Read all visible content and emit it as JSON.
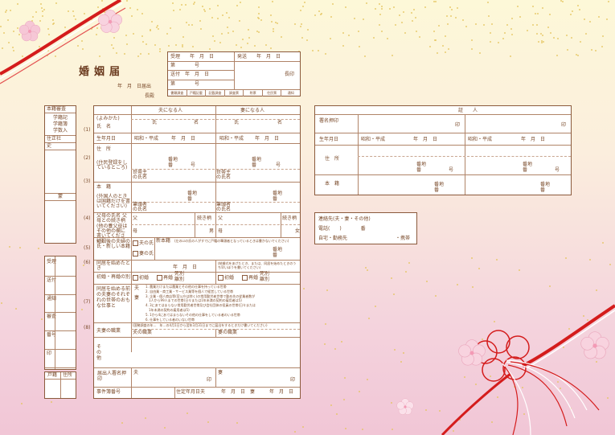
{
  "form": {
    "title": "婚姻届",
    "date_line": "年　月　日届出",
    "to_line": "長殿",
    "reception": {
      "rows": [
        "受理　　年　月　日",
        "第　　　　号",
        "送付　年　月　日",
        "第　　　　号"
      ],
      "right_rows": [
        "発送　　年　月　日",
        "",
        "長印",
        ""
      ],
      "footer": [
        "書類調査",
        "戸籍記載",
        "記載調査",
        "調査票",
        "附票",
        "住民票",
        "通知"
      ]
    },
    "left_strip": {
      "header": "本籍審査",
      "items": [
        "学籍記",
        "学籍簿",
        "学数入"
      ],
      "label2": "住正社",
      "label3": "史",
      "label4": "蒙"
    },
    "columns": {
      "husband": "夫になる人",
      "wife": "妻になる人"
    },
    "rows": {
      "furigana": "(よみかた)",
      "name": "氏　名",
      "family": "氏",
      "given": "名",
      "birth": "生年月日",
      "era": "昭和・平成",
      "ymd": "年　月　日",
      "address": "住　所",
      "address_note": "(住民登録をしているところ)",
      "banchi": "番地",
      "ban": "番",
      "go": "号",
      "setainushi": "世帯主の氏名",
      "honseki": "本　籍",
      "honseki_note": "(外国人のときは国籍だけを書いてください)",
      "hittousha": "筆頭者の氏名",
      "parents": "父母の氏名 父母との続き柄",
      "parents_note": "(他の養父母は その他の欄に 書いてください)",
      "father": "父",
      "mother": "母",
      "relation": "続き柄",
      "son": "男",
      "daughter": "女",
      "new_honseki": "婚姻後の夫婦の 氏・新しい本籍",
      "husband_name": "夫の氏",
      "wife_name": "妻の氏",
      "new_honseki_label": "新本籍",
      "new_honseki_note": "(左の☑の氏の人がすでに戸籍の筆頭者となっているときは書かないでください)",
      "cohabit": "同居を始めたとき",
      "cohabit_note": "(結婚式をあげたとき、または、同居を始めたときのうち早いほうを書いてください)",
      "remarriage": "初婚・再婚の別",
      "first": "初婚",
      "again": "再婚",
      "death": "死別",
      "divorce": "離別",
      "jobs_label": "同居を始める前の夫妻のそれぞれの世帯のおもな仕事と",
      "job_list": [
        "1. 農業だけまたは農業とその他の仕事を持っている世帯",
        "2. 自由業・商工業・サービス業等を個人で経営している世帯",
        "3. 企業・個人商店等(官公庁は除く)の常用勤労者世帯で勤め先の従業者数が",
        "　1人から99人までの世帯(日々または1年未満の契約の雇用者は5)",
        "4. 3にあてはまらない常用勤労者世帯及び会社団体の役員の世帯(日々または",
        "　1年未満の契約の雇用者は5)",
        "5. 1から4にあてはまらないその他の仕事をしている者のいる世帯",
        "6. 仕事をしている者のいない世帯"
      ],
      "occupation": "夫妻の職業",
      "occupation_note": "(国勢調査の年…　年…の4月1日から翌年3月31日までに届出をするときだけ書いてください)",
      "h_job": "夫の職業",
      "w_job": "妻の職業",
      "other": "その他",
      "signer": "届出人署名押印",
      "seal": "印",
      "case_no": "事件簿番号",
      "birthday_fix": "住定年月日",
      "ymd2": "年　月　日",
      "h": "夫",
      "w": "妻"
    },
    "row_numbers": [
      "(1)",
      "(2)",
      "(3)",
      "(4)",
      "(5)",
      "(6)",
      "(7)",
      "(8)"
    ],
    "witness": {
      "title": "証　　人",
      "signature": "署名押印",
      "seal": "印",
      "birth": "生年月日",
      "era": "昭和・平成",
      "ymd": "年　月　日",
      "address": "住　所",
      "honseki": "本　籍",
      "banchi": "番地",
      "ban": "番",
      "go": "号"
    },
    "contact": {
      "title": "連絡先(夫・妻・その他)",
      "phone": "電話(　　)　　　　番",
      "home": "自宅・勤務先",
      "mobile": "・携帯"
    },
    "left_lower": {
      "items": [
        "受理",
        "送付",
        "通知",
        "審査",
        "番号",
        "印"
      ],
      "footer": [
        "戸籍",
        "住所"
      ]
    }
  },
  "colors": {
    "line": "#8b5a3c",
    "cord_red": "#d41c1c",
    "blossom": "#f6c7d6"
  }
}
